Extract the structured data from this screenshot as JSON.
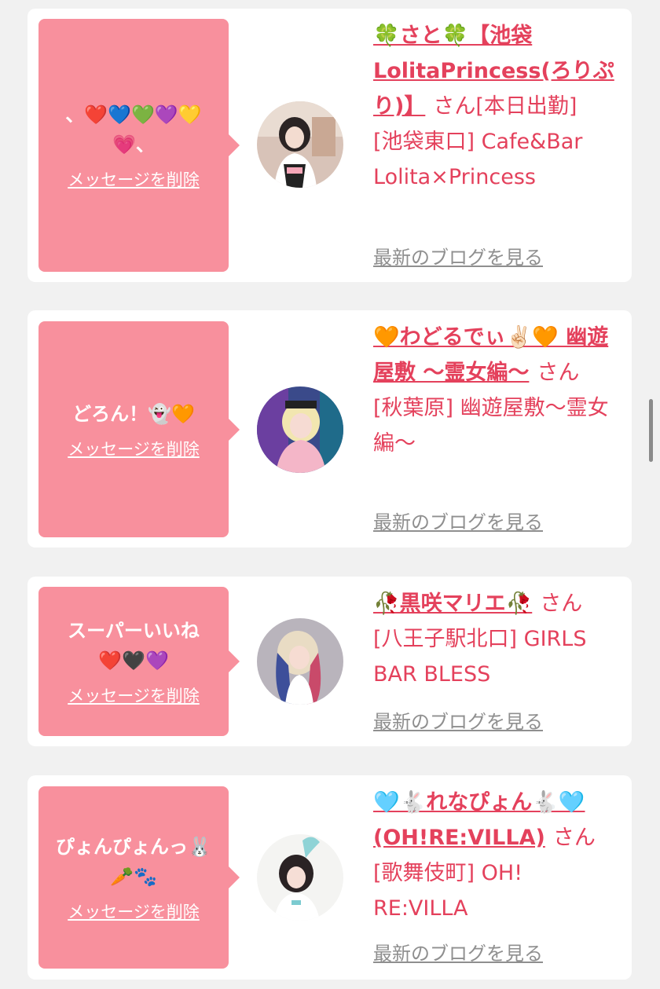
{
  "delete_label": "メッセージを削除",
  "blog_label": "最新のブログを見る",
  "san_label": "さん",
  "colors": {
    "accent": "#e4415c",
    "bubble": "#f8909d",
    "background": "#f1f1f1"
  },
  "cards": [
    {
      "message_line1": "、❤️💙💚💜💛",
      "message_line2": "💗、",
      "name": "🍀さと🍀【池袋LolitaPrincess(ろりぷり)】",
      "extra": "[本日出勤]",
      "location": "[池袋東口] Cafe&Bar Lolita×Princess"
    },
    {
      "message_line1": "どろん！👻🧡",
      "message_line2": "",
      "name": "🧡わどるでぃ✌🏻🧡 幽遊屋敷 〜霊女編〜",
      "extra": "",
      "location": "[秋葉原] 幽遊屋敷〜霊女編〜"
    },
    {
      "message_line1": "スーパーいいね",
      "message_line2": "❤️🖤💜",
      "name": "🥀黒咲マリエ🥀",
      "extra": "",
      "location": "[八王子駅北口] GIRLS BAR BLESS"
    },
    {
      "message_line1": "ぴょんぴょんっ🐰",
      "message_line2": "🥕🐾",
      "name": "🩵🐇れなぴょん🐇🩵(OH!RE:VILLA)",
      "extra": "",
      "location": "[歌舞伎町] OH! RE:VILLA"
    }
  ]
}
